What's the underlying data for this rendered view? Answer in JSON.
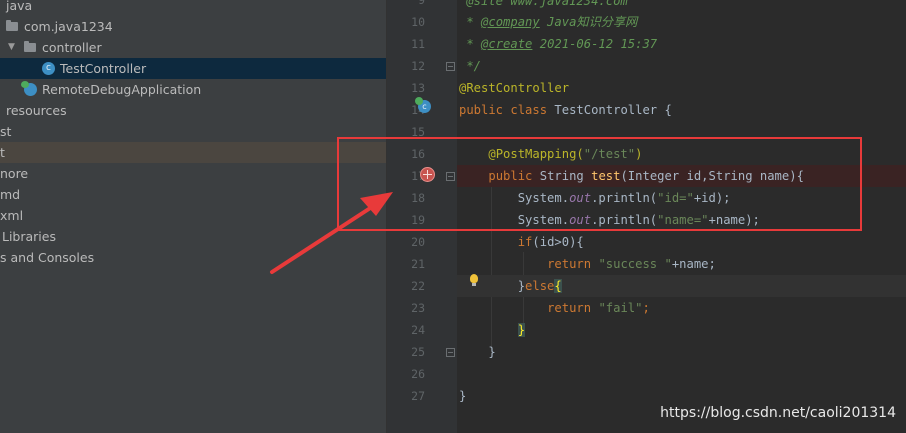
{
  "project_tree": [
    {
      "label": "java",
      "indent": 6
    },
    {
      "label": "com.java1234",
      "indent": 24,
      "icon": "package"
    },
    {
      "label": "controller",
      "indent": 42,
      "icon": "package",
      "expanded": true
    },
    {
      "label": "TestController",
      "indent": 60,
      "icon": "class",
      "selected": true
    },
    {
      "label": "RemoteDebugApplication",
      "indent": 42,
      "icon": "spring-app"
    },
    {
      "label": "resources",
      "indent": 6
    },
    {
      "label": "st",
      "indent": 0
    },
    {
      "label": "t",
      "indent": 0,
      "muted": true
    },
    {
      "label": "nore",
      "indent": 0
    },
    {
      "label": "md",
      "indent": 0
    },
    {
      "label": "xml",
      "indent": 0
    },
    {
      "label": "Libraries",
      "indent": 2
    },
    {
      "label": "s and Consoles",
      "indent": 0
    }
  ],
  "line_numbers": [
    "9",
    "10",
    "11",
    "12",
    "13",
    "14",
    "15",
    "16",
    "17",
    "18",
    "19",
    "20",
    "21",
    "22",
    "23",
    "24",
    "25",
    "26",
    "27"
  ],
  "code": {
    "top_partial": " @site www.java1234.com",
    "company_tag": "@company",
    "company_text": " Java知识分享网",
    "create_tag": "@create",
    "create_text": " 2021-06-12 15:37",
    "comment_star": " * ",
    "comment_end": " */",
    "rest_controller": "@RestController",
    "kw_public": "public ",
    "kw_class": "class ",
    "class_name": "TestController {",
    "post_mapping": "@PostMapping(",
    "post_path": "\"/test\"",
    "close_paren": ")",
    "method_ret": "String ",
    "method_name": "test",
    "method_params": "(Integer id,String name){",
    "sys_out_1": "System.",
    "out_field": "out",
    "println_open": ".println(",
    "str_id": "\"id=\"",
    "plus_id": "+id);",
    "str_name": "\"name=\"",
    "plus_name": "+name);",
    "kw_if": "if",
    "if_cond": "(id>0){",
    "kw_return": "return ",
    "str_success": "\"success \"",
    "plus_name_semi": "+name;",
    "close_brace": "}",
    "kw_else": "else",
    "open_brace": "{",
    "str_fail": "\"fail\"",
    "semi": ";"
  },
  "watermark": "https://blog.csdn.net/caoli201314",
  "colors": {
    "annotation_box": "#e83a3a",
    "keyword": "#cc7832",
    "string": "#6a8759"
  }
}
